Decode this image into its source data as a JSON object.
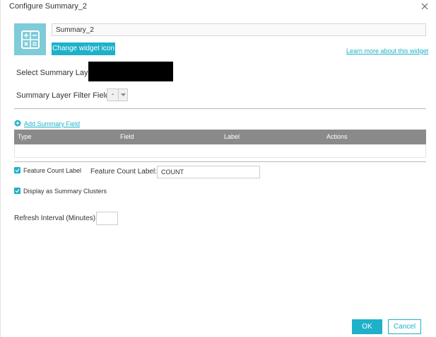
{
  "dialog": {
    "title": "Configure Summary_2",
    "close_icon": "close-icon"
  },
  "widget": {
    "icon": "calculator-icon",
    "name_value": "Summary_2",
    "change_icon_label": "Change widget icon",
    "learn_more_label": "Learn more about this widget"
  },
  "layer": {
    "label": "Select Summary Layer:"
  },
  "filter": {
    "label": "Summary Layer Filter Field:",
    "selected": "-"
  },
  "fields": {
    "add_label": "Add Summary Field",
    "columns": [
      "Type",
      "Field",
      "Label",
      "Actions"
    ],
    "rows": []
  },
  "feature_count": {
    "checkbox_label": "Feature Count Label",
    "checked": true,
    "input_label": "Feature Count Label:",
    "input_value": "COUNT"
  },
  "clusters": {
    "checkbox_label": "Display as Summary Clusters",
    "checked": true
  },
  "refresh": {
    "label": "Refresh Interval (Minutes):",
    "value": ""
  },
  "footer": {
    "ok_label": "OK",
    "cancel_label": "Cancel"
  },
  "colors": {
    "accent": "#1eb1c9",
    "icon_bg": "#7ecbd9",
    "table_header": "#8a8a8a"
  }
}
